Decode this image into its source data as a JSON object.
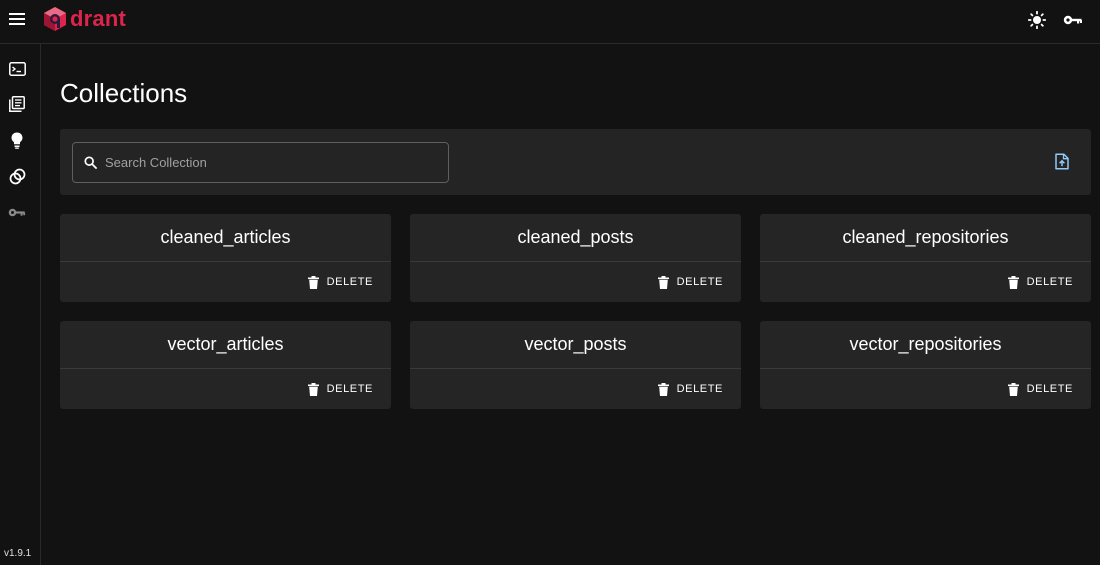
{
  "app": {
    "logo_text": "drant",
    "version": "v1.9.1"
  },
  "page": {
    "title": "Collections"
  },
  "search": {
    "placeholder": "Search Collection",
    "value": ""
  },
  "collections": [
    {
      "name": "cleaned_articles",
      "action_label": "DELETE"
    },
    {
      "name": "cleaned_posts",
      "action_label": "DELETE"
    },
    {
      "name": "cleaned_repositories",
      "action_label": "DELETE"
    },
    {
      "name": "vector_articles",
      "action_label": "DELETE"
    },
    {
      "name": "vector_posts",
      "action_label": "DELETE"
    },
    {
      "name": "vector_repositories",
      "action_label": "DELETE"
    }
  ],
  "icons": {
    "menu": "hamburger-menu-icon",
    "theme": "sun-icon",
    "api_key": "key-icon",
    "sidebar": [
      "terminal-icon",
      "collections-icon",
      "lightbulb-icon",
      "datasets-icon",
      "key-icon"
    ],
    "search": "search-icon",
    "upload": "upload-file-icon",
    "delete": "trash-icon"
  },
  "colors": {
    "brand": "#dc244c",
    "background": "#121212",
    "panel": "#242424",
    "card": "#252525"
  }
}
